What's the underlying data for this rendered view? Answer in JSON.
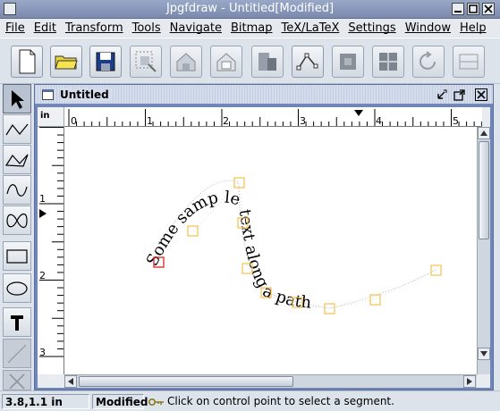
{
  "window": {
    "title": "Jpgfdraw - Untitled[Modified]"
  },
  "menu": [
    "File",
    "Edit",
    "Transform",
    "Tools",
    "Navigate",
    "Bitmap",
    "TeX/LaTeX",
    "Settings",
    "Window",
    "Help"
  ],
  "toolbar": {
    "buttons": [
      "new-file-icon",
      "open-folder-icon",
      "save-disk-icon",
      "select-region-icon",
      "move-to-back-icon",
      "group-icon",
      "ungroup-icon",
      "edit-path-icon",
      "reduce-icon",
      "combine-icon",
      "rotate-icon",
      "justify-icon"
    ]
  },
  "palette": [
    "select-arrow-icon",
    "open-line-icon",
    "closed-line-icon",
    "open-curve-icon",
    "closed-curve-icon",
    "rectangle-icon",
    "ellipse-icon",
    "text-icon",
    "math-icon",
    "more-tools-icon"
  ],
  "document": {
    "title": "Untitled",
    "ruler_unit": "in",
    "h_ruler_labels": [
      "0",
      "1",
      "2",
      "3",
      "4",
      "5"
    ],
    "v_ruler_labels": [
      "1",
      "2",
      "3"
    ],
    "path_text": "Some samp le text along a path"
  },
  "status": {
    "coords": "3.8,1.1 in",
    "state": "Modified",
    "message": "Click on control point to select a segment."
  },
  "colors": {
    "control_point": "#f2c14e",
    "selected_point": "#e03030",
    "title_bar": "#8796ba"
  }
}
